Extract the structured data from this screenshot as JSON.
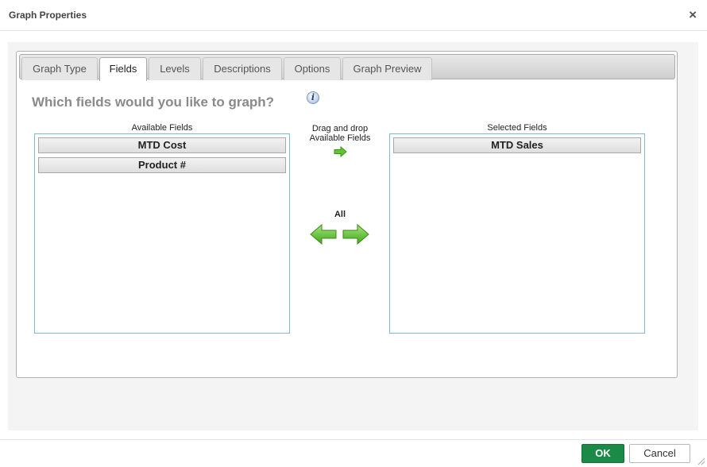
{
  "dialog": {
    "title": "Graph Properties",
    "close_glyph": "×"
  },
  "tabs": [
    {
      "label": "Graph Type",
      "active": false
    },
    {
      "label": "Fields",
      "active": true
    },
    {
      "label": "Levels",
      "active": false
    },
    {
      "label": "Descriptions",
      "active": false
    },
    {
      "label": "Options",
      "active": false
    },
    {
      "label": "Graph Preview",
      "active": false
    }
  ],
  "fields_tab": {
    "question": "Which fields would you like to graph?",
    "info_glyph": "i",
    "available": {
      "label": "Available Fields",
      "items": [
        "MTD Cost",
        "Product #"
      ]
    },
    "selected": {
      "label": "Selected Fields",
      "items": [
        "MTD Sales"
      ]
    },
    "drag_hint": {
      "line1": "Drag and drop",
      "line2": "Available Fields"
    },
    "all_label": "All"
  },
  "footer": {
    "ok_label": "OK",
    "cancel_label": "Cancel"
  },
  "colors": {
    "ok_button": "#1b8a46",
    "arrow_green": "#5cc22a",
    "list_border": "#7fb9d1",
    "question_text": "#8a8a8a"
  }
}
